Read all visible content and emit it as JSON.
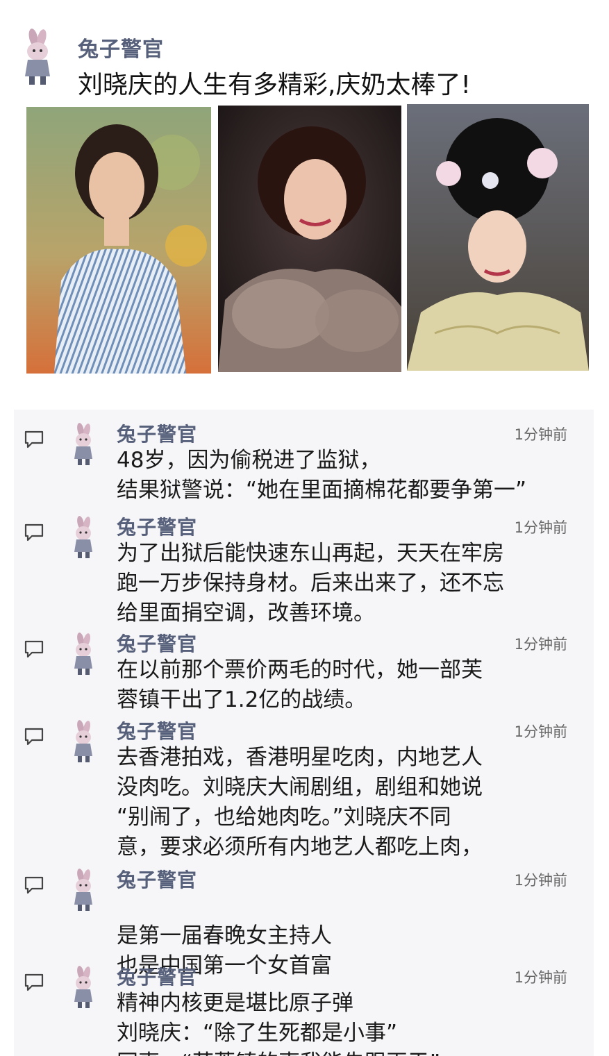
{
  "post": {
    "author": "兔子警官",
    "title": "刘晓庆的人生有多精彩,庆奶太棒了!"
  },
  "photos": [
    {
      "icon": "portrait-photo-striped-shirt"
    },
    {
      "icon": "portrait-photo-fur-stole"
    },
    {
      "icon": "portrait-photo-traditional-costume"
    }
  ],
  "comments": [
    {
      "author": "兔子警官",
      "time": "1分钟前",
      "lines": [
        "48岁，因为偷税进了监狱，",
        "结果狱警说：“她在里面摘棉花都要争第一”"
      ]
    },
    {
      "author": "兔子警官",
      "time": "1分钟前",
      "lines": [
        "为了出狱后能快速东山再起，天天在牢房",
        "跑一万步保持身材。后来出来了，还不忘",
        "给里面捐空调，改善环境。"
      ]
    },
    {
      "author": "兔子警官",
      "time": "1分钟前",
      "lines": [
        "在以前那个票价两毛的时代，她一部芙",
        "蓉镇干出了1.2亿的战绩。"
      ]
    },
    {
      "author": "兔子警官",
      "time": "1分钟前",
      "lines": [
        "去香港拍戏，香港明星吃肉，内地艺人",
        "没肉吃。刘晓庆大闹剧组，剧组和她说",
        "“别闹了，也给她肉吃。”刘晓庆不同",
        "意，要求必须所有内地艺人都吃上肉，"
      ]
    },
    {
      "author": "兔子警官",
      "time": "1分钟前",
      "lines": [
        "",
        "是第一届春晚女主持人",
        "也是中国第一个女首富"
      ]
    },
    {
      "author": "兔子警官",
      "time": "1分钟前",
      "lines": [
        "精神内核更是堪比原子弹",
        "刘晓庆：“除了生死都是小事”",
        "同事：“芙蓉镇的事我能先跟再于”"
      ]
    }
  ],
  "colors": {
    "author": "#56607a",
    "comments_bg": "#f6f6f8",
    "time": "#666666"
  }
}
